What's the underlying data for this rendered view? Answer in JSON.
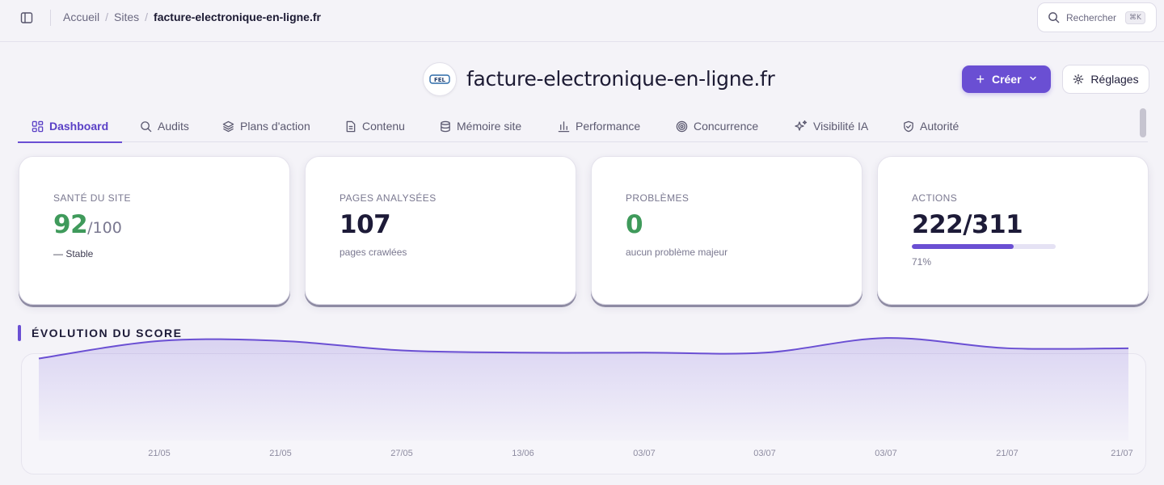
{
  "topbar": {
    "breadcrumb": [
      "Accueil",
      "Sites",
      "facture-electronique-en-ligne.fr"
    ],
    "search_label": "Rechercher",
    "search_shortcut": "⌘K"
  },
  "site": {
    "title": "facture-electronique-en-ligne.fr",
    "logo_text": "FEL",
    "create_label": "Créer",
    "settings_label": "Réglages"
  },
  "tabs": [
    {
      "label": "Dashboard",
      "icon": "dashboard-icon",
      "active": true
    },
    {
      "label": "Audits",
      "icon": "search-icon"
    },
    {
      "label": "Plans d'action",
      "icon": "layers-icon"
    },
    {
      "label": "Contenu",
      "icon": "document-icon"
    },
    {
      "label": "Mémoire site",
      "icon": "database-icon"
    },
    {
      "label": "Performance",
      "icon": "bar-chart-icon"
    },
    {
      "label": "Concurrence",
      "icon": "target-icon"
    },
    {
      "label": "Visibilité IA",
      "icon": "sparkles-icon"
    },
    {
      "label": "Autorité",
      "icon": "shield-icon"
    }
  ],
  "cards": {
    "health": {
      "label": "Santé du site",
      "value": "92",
      "suffix": "/100",
      "sub": "— Stable"
    },
    "pages": {
      "label": "Pages analysées",
      "value": "107",
      "sub": "pages crawlées"
    },
    "problems": {
      "label": "Problèmes",
      "value": "0",
      "sub": "aucun problème majeur"
    },
    "actions": {
      "label": "Actions",
      "value": "222/311",
      "progress": 0.71,
      "sub": "71%"
    }
  },
  "colors": {
    "accent": "#6a4fd3",
    "good": "#3f9a5b"
  },
  "section": {
    "title": "Évolution du score"
  },
  "chart_data": {
    "type": "area",
    "x": [
      "",
      "21/05",
      "21/05",
      "27/05",
      "13/06",
      "03/07",
      "03/07",
      "03/07",
      "21/07",
      "21/07"
    ],
    "values": [
      91.2,
      93.6,
      93.6,
      92.3,
      92.0,
      92.0,
      92.0,
      94.0,
      92.6,
      92.6
    ],
    "xlabel": "",
    "ylabel": "",
    "grid": false
  }
}
